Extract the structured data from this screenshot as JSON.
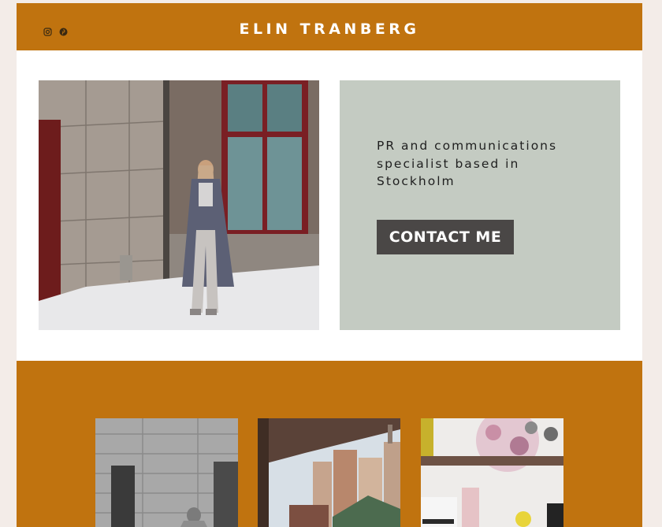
{
  "header": {
    "title": "ELIN TRANBERG",
    "social_icons": [
      "instagram-icon",
      "pinterest-icon"
    ]
  },
  "intro": {
    "text": "PR and communications specialist based in Stockholm",
    "contact_label": "CONTACT ME"
  },
  "colors": {
    "brand_orange": "#c0730f",
    "panel_sage": "#c4cbc2",
    "button_dark": "#4a4746",
    "page_background": "#f3ece8"
  },
  "gallery": {
    "images": [
      "black-and-white-street-photo",
      "city-street-market-photo",
      "shelf-with-perfume-photo"
    ]
  }
}
